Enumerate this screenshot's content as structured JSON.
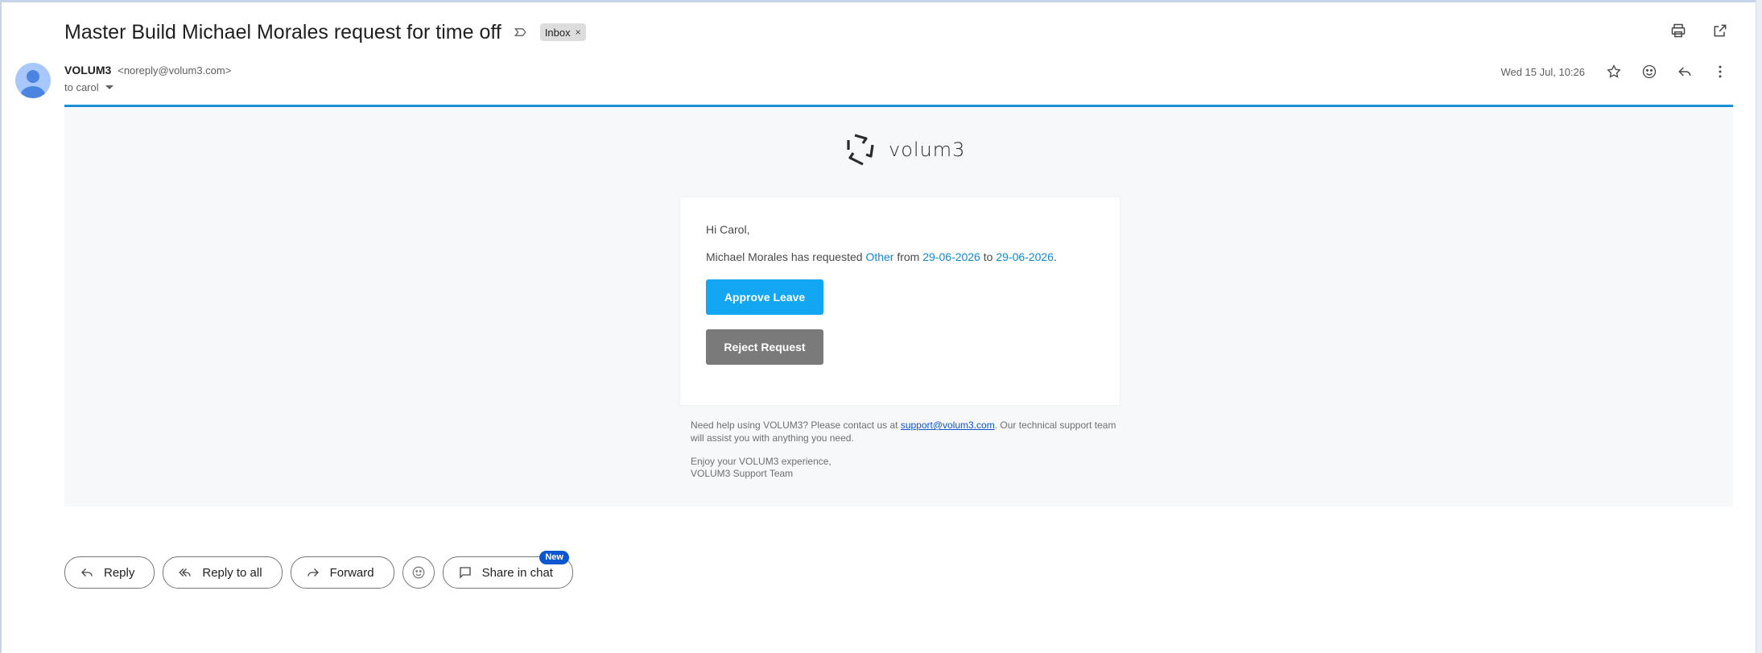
{
  "email": {
    "subject": "Master Build Michael Morales request for time off",
    "label_chip": "Inbox",
    "label_chip_close": "×",
    "sender_name": "VOLUM3",
    "sender_email": "<noreply@volum3.com>",
    "to_line": "to carol",
    "date": "Wed 15 Jul, 10:26"
  },
  "body": {
    "logo_text": "volum3",
    "greeting": "Hi Carol,",
    "request": {
      "prefix": "Michael Morales has requested ",
      "leave_type": "Other",
      "from_word": " from ",
      "start_date": "29-06-2026",
      "to_word": " to ",
      "end_date": "29-06-2026",
      "suffix": "."
    },
    "approve_label": "Approve Leave",
    "reject_label": "Reject Request",
    "help_prefix": "Need help using VOLUM3? Please contact us at ",
    "help_email": "support@volum3.com",
    "help_suffix": ". Our technical support team will assist you with anything you need.",
    "sign_line1": "Enjoy your VOLUM3 experience,",
    "sign_line2": "VOLUM3 Support Team"
  },
  "actions": {
    "reply": "Reply",
    "reply_all": "Reply to all",
    "forward": "Forward",
    "share_chat": "Share in chat",
    "new_badge": "New"
  },
  "icons": {
    "top": [
      "print-icon",
      "open-in-new-window-icon"
    ],
    "meta": [
      "star-icon",
      "emoji-icon",
      "reply-icon",
      "more-vert-icon"
    ]
  },
  "colors": {
    "accent_rule": "#1a8fd6",
    "approve": "#13a6f3",
    "reject": "#7a7a7a",
    "highlight": "#0f8ad2",
    "new_badge": "#0b57d0"
  }
}
